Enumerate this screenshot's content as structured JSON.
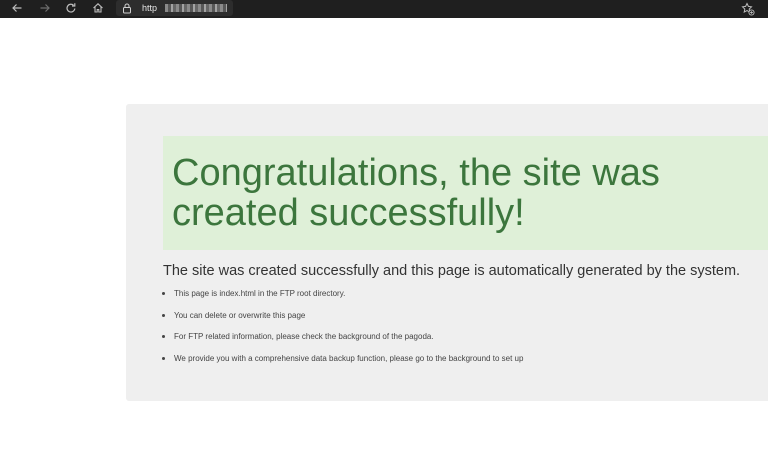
{
  "browser": {
    "url_prefix": "http",
    "icons": {
      "back": "back-arrow-icon",
      "forward": "forward-arrow-icon",
      "reload": "reload-icon",
      "home": "home-icon",
      "security": "lock-icon",
      "favorites": "add-favorite-icon"
    }
  },
  "page": {
    "headline": "Congratulations, the site was created successfully!",
    "subheading": "The site was created successfully and this page is automatically generated by the system.",
    "bullets": [
      "This page is index.html in the FTP root directory.",
      "You can delete or overwrite this page",
      "For FTP related information, please check the background of the pagoda.",
      "We provide you with a comprehensive data backup function, please go to the background to set up"
    ]
  },
  "colors": {
    "toolbar_bg": "#1f1f1f",
    "panel_bg": "#efefef",
    "banner_bg": "#dff0d8",
    "headline_text": "#3c763d"
  }
}
